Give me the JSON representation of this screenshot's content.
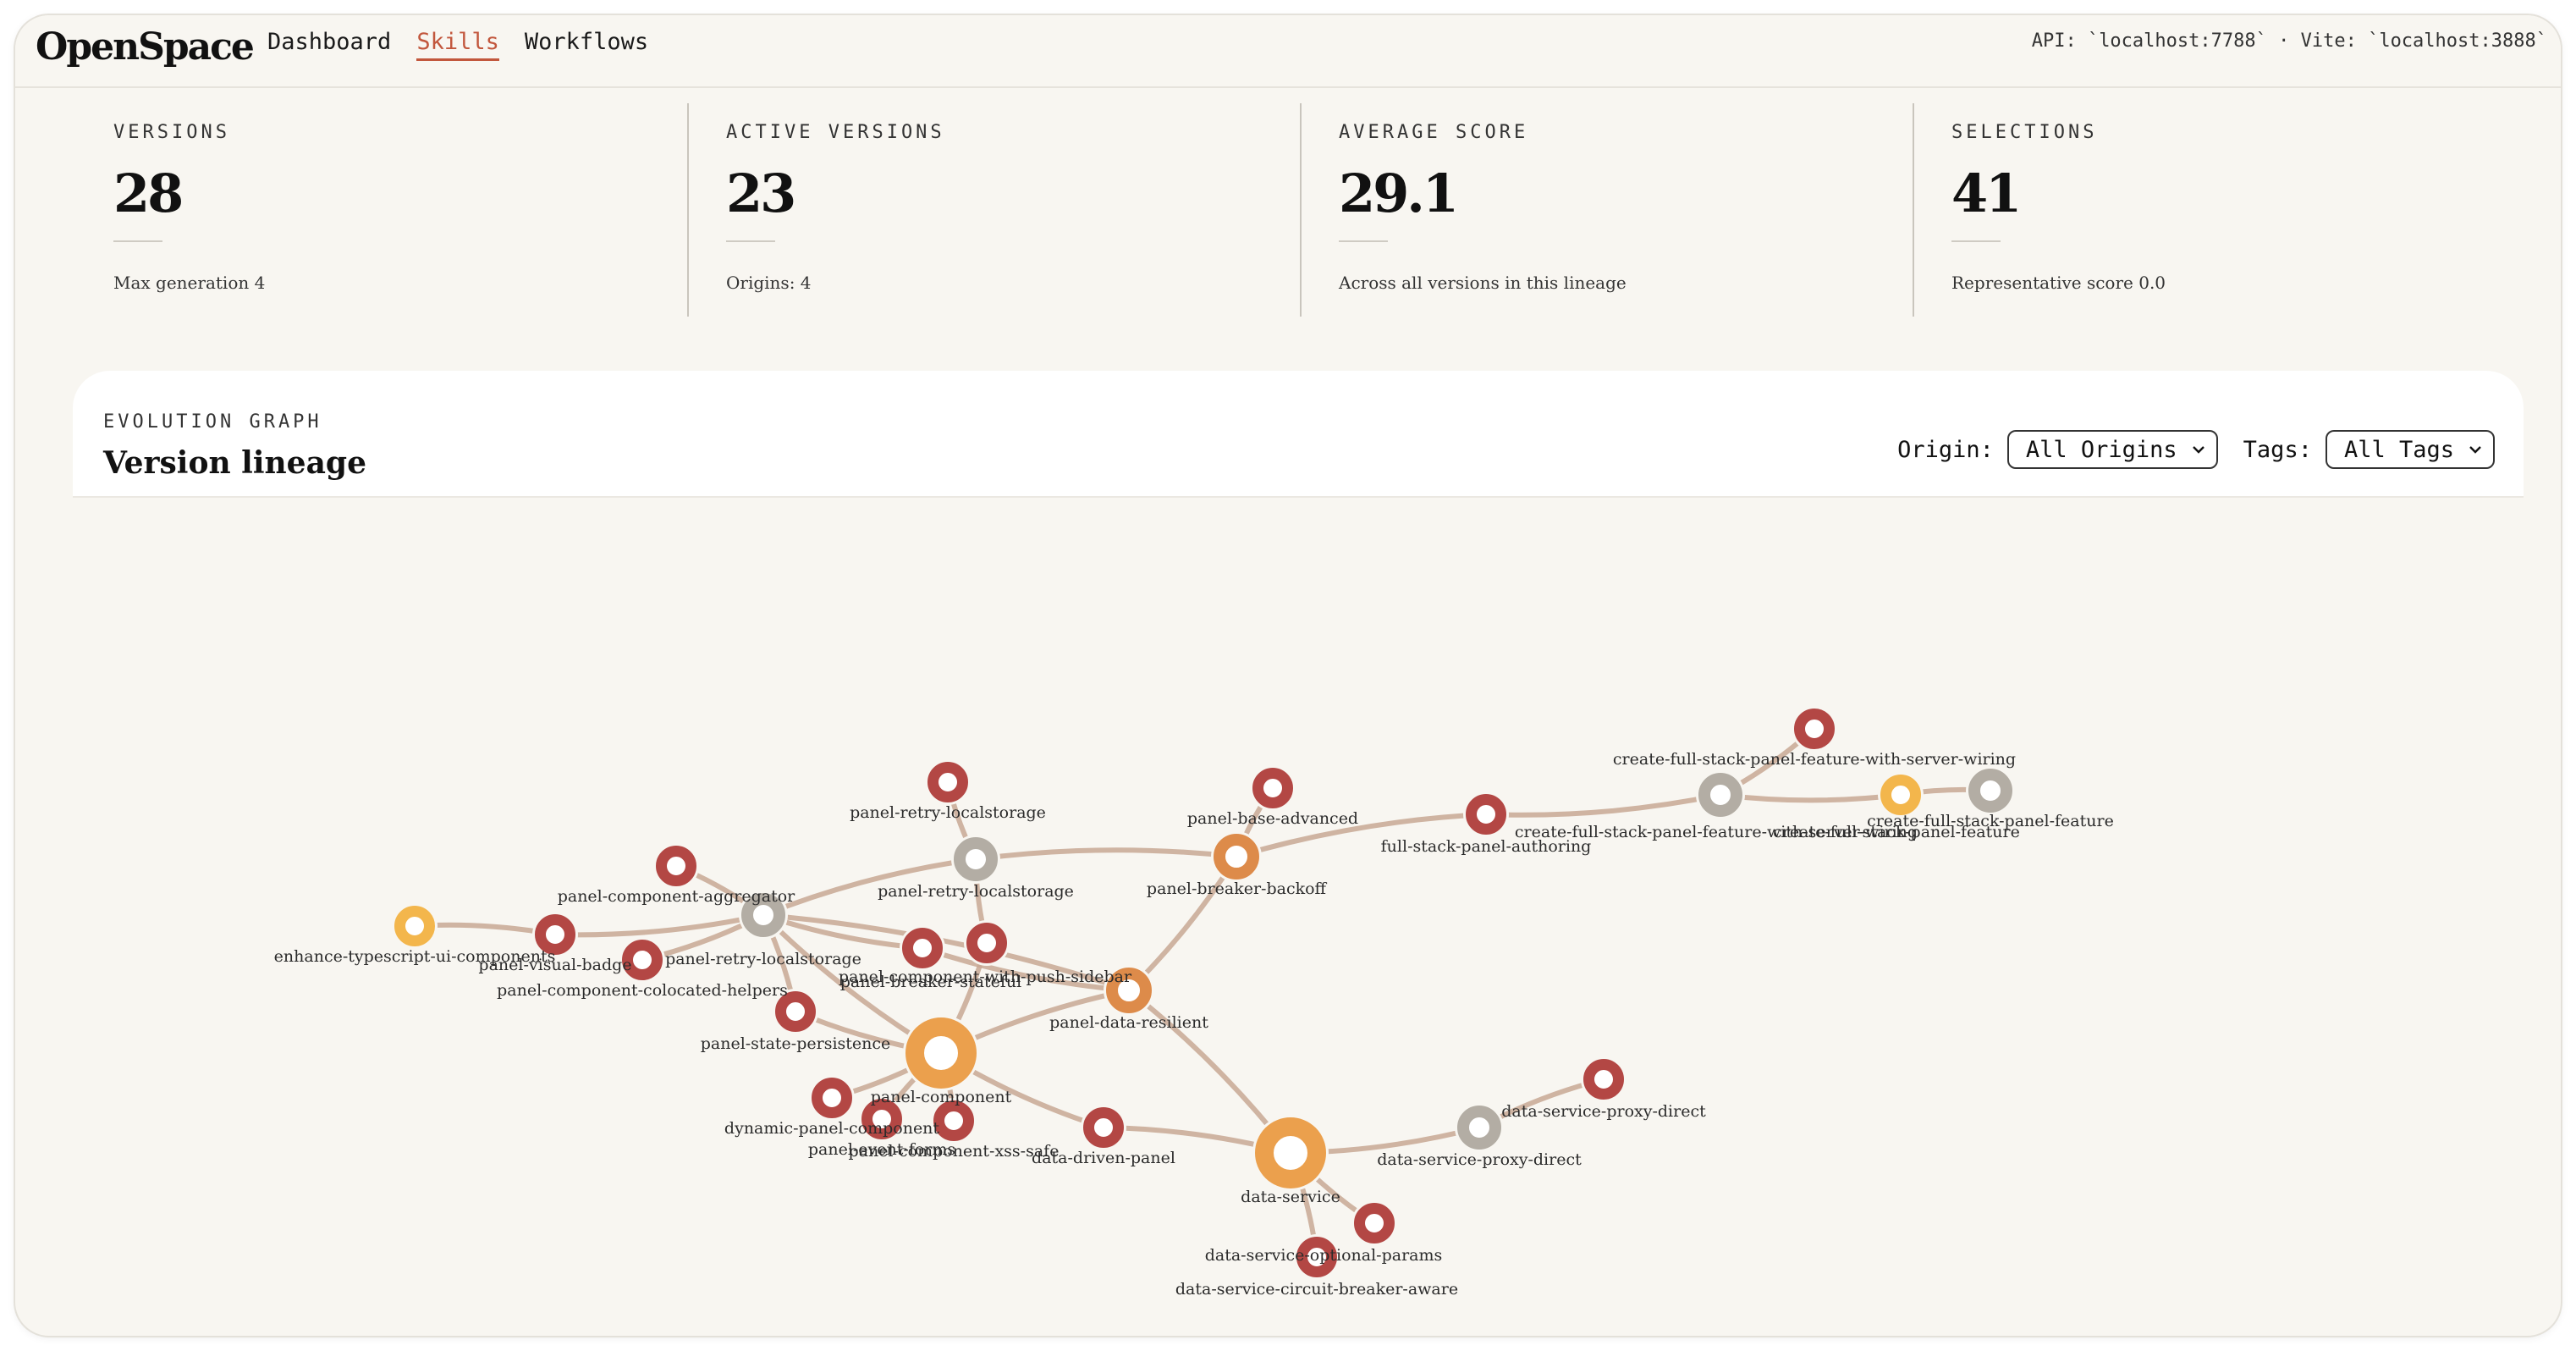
{
  "header": {
    "logo": "OpenSpace",
    "nav": [
      "Dashboard",
      "Skills",
      "Workflows"
    ],
    "active_nav": "Skills",
    "api_info": "API: `localhost:7788` · Vite: `localhost:3888`"
  },
  "stats": [
    {
      "label": "VERSIONS",
      "value": "28",
      "note": "Max generation 4"
    },
    {
      "label": "ACTIVE VERSIONS",
      "value": "23",
      "note": "Origins: 4"
    },
    {
      "label": "AVERAGE SCORE",
      "value": "29.1",
      "note": "Across all versions in this lineage"
    },
    {
      "label": "SELECTIONS",
      "value": "41",
      "note": "Representative score 0.0"
    }
  ],
  "graph_panel": {
    "eyebrow": "EVOLUTION GRAPH",
    "title": "Version lineage",
    "origin_label": "Origin:",
    "origin_value": "All Origins",
    "tags_label": "Tags:",
    "tags_value": "All Tags"
  },
  "colors": {
    "accent": "#c2573d",
    "node_red": "#b34744",
    "node_orange": "#dd8b4a",
    "node_big": "#eba04d",
    "node_yellow": "#f3b64c",
    "node_gray": "#b3ada4",
    "edge": "#c8a894"
  },
  "graph": {
    "nodes": [
      {
        "id": "n1",
        "label": "enhance-typescript-ui-components",
        "kind": "yellow"
      },
      {
        "id": "n2",
        "label": "panel-visual-badge",
        "kind": "red"
      },
      {
        "id": "n3",
        "label": "panel-component-aggregator",
        "kind": "red"
      },
      {
        "id": "n4",
        "label": "panel-component-colocated-helpers",
        "kind": "red"
      },
      {
        "id": "n5",
        "label": "panel-retry-localstorage",
        "kind": "gray"
      },
      {
        "id": "n6",
        "label": "panel-retry-localstorage",
        "kind": "red"
      },
      {
        "id": "n7",
        "label": "panel-retry-localstorage",
        "kind": "gray"
      },
      {
        "id": "n8",
        "label": "panel-breaker-stateful",
        "kind": "red"
      },
      {
        "id": "n9",
        "label": "panel-component-with-push-sidebar",
        "kind": "red"
      },
      {
        "id": "n10",
        "label": "panel-base-advanced",
        "kind": "red"
      },
      {
        "id": "n11",
        "label": "panel-breaker-backoff",
        "kind": "orange"
      },
      {
        "id": "n12",
        "label": "full-stack-panel-authoring",
        "kind": "red"
      },
      {
        "id": "n13",
        "label": "create-full-stack-panel-feature-with-server-wiring",
        "kind": "red"
      },
      {
        "id": "n14",
        "label": "create-full-stack-panel-feature-with-server-wiring",
        "kind": "gray"
      },
      {
        "id": "n15",
        "label": "create-full-stack-panel-feature",
        "kind": "yellow"
      },
      {
        "id": "n16",
        "label": "create-full-stack-panel-feature",
        "kind": "gray"
      },
      {
        "id": "n17",
        "label": "panel-data-resilient",
        "kind": "orange"
      },
      {
        "id": "n18",
        "label": "panel-state-persistence",
        "kind": "red"
      },
      {
        "id": "n19",
        "label": "panel-component",
        "kind": "big"
      },
      {
        "id": "n20",
        "label": "dynamic-panel-component",
        "kind": "red"
      },
      {
        "id": "n21",
        "label": "panel-event-forms",
        "kind": "red"
      },
      {
        "id": "n22",
        "label": "panel-component-xss-safe",
        "kind": "red"
      },
      {
        "id": "n23",
        "label": "data-driven-panel",
        "kind": "red"
      },
      {
        "id": "n24",
        "label": "data-service",
        "kind": "big"
      },
      {
        "id": "n25",
        "label": "data-service-proxy-direct",
        "kind": "gray"
      },
      {
        "id": "n26",
        "label": "data-service-proxy-direct",
        "kind": "red"
      },
      {
        "id": "n27",
        "label": "data-service-optional-params",
        "kind": "red"
      },
      {
        "id": "n28",
        "label": "data-service-circuit-breaker-aware",
        "kind": "red"
      }
    ],
    "edges": [
      [
        "n1",
        "n2"
      ],
      [
        "n2",
        "n5"
      ],
      [
        "n3",
        "n5"
      ],
      [
        "n4",
        "n5"
      ],
      [
        "n5",
        "n7"
      ],
      [
        "n6",
        "n7"
      ],
      [
        "n7",
        "n11"
      ],
      [
        "n10",
        "n11"
      ],
      [
        "n11",
        "n12"
      ],
      [
        "n12",
        "n14"
      ],
      [
        "n13",
        "n14"
      ],
      [
        "n14",
        "n15"
      ],
      [
        "n15",
        "n16"
      ],
      [
        "n5",
        "n8"
      ],
      [
        "n5",
        "n17"
      ],
      [
        "n7",
        "n9"
      ],
      [
        "n9",
        "n19"
      ],
      [
        "n8",
        "n17"
      ],
      [
        "n11",
        "n17"
      ],
      [
        "n17",
        "n19"
      ],
      [
        "n17",
        "n24"
      ],
      [
        "n5",
        "n19"
      ],
      [
        "n5",
        "n18"
      ],
      [
        "n18",
        "n19"
      ],
      [
        "n19",
        "n20"
      ],
      [
        "n19",
        "n21"
      ],
      [
        "n19",
        "n22"
      ],
      [
        "n19",
        "n23"
      ],
      [
        "n23",
        "n24"
      ],
      [
        "n24",
        "n25"
      ],
      [
        "n25",
        "n26"
      ],
      [
        "n24",
        "n27"
      ],
      [
        "n24",
        "n28"
      ]
    ]
  }
}
